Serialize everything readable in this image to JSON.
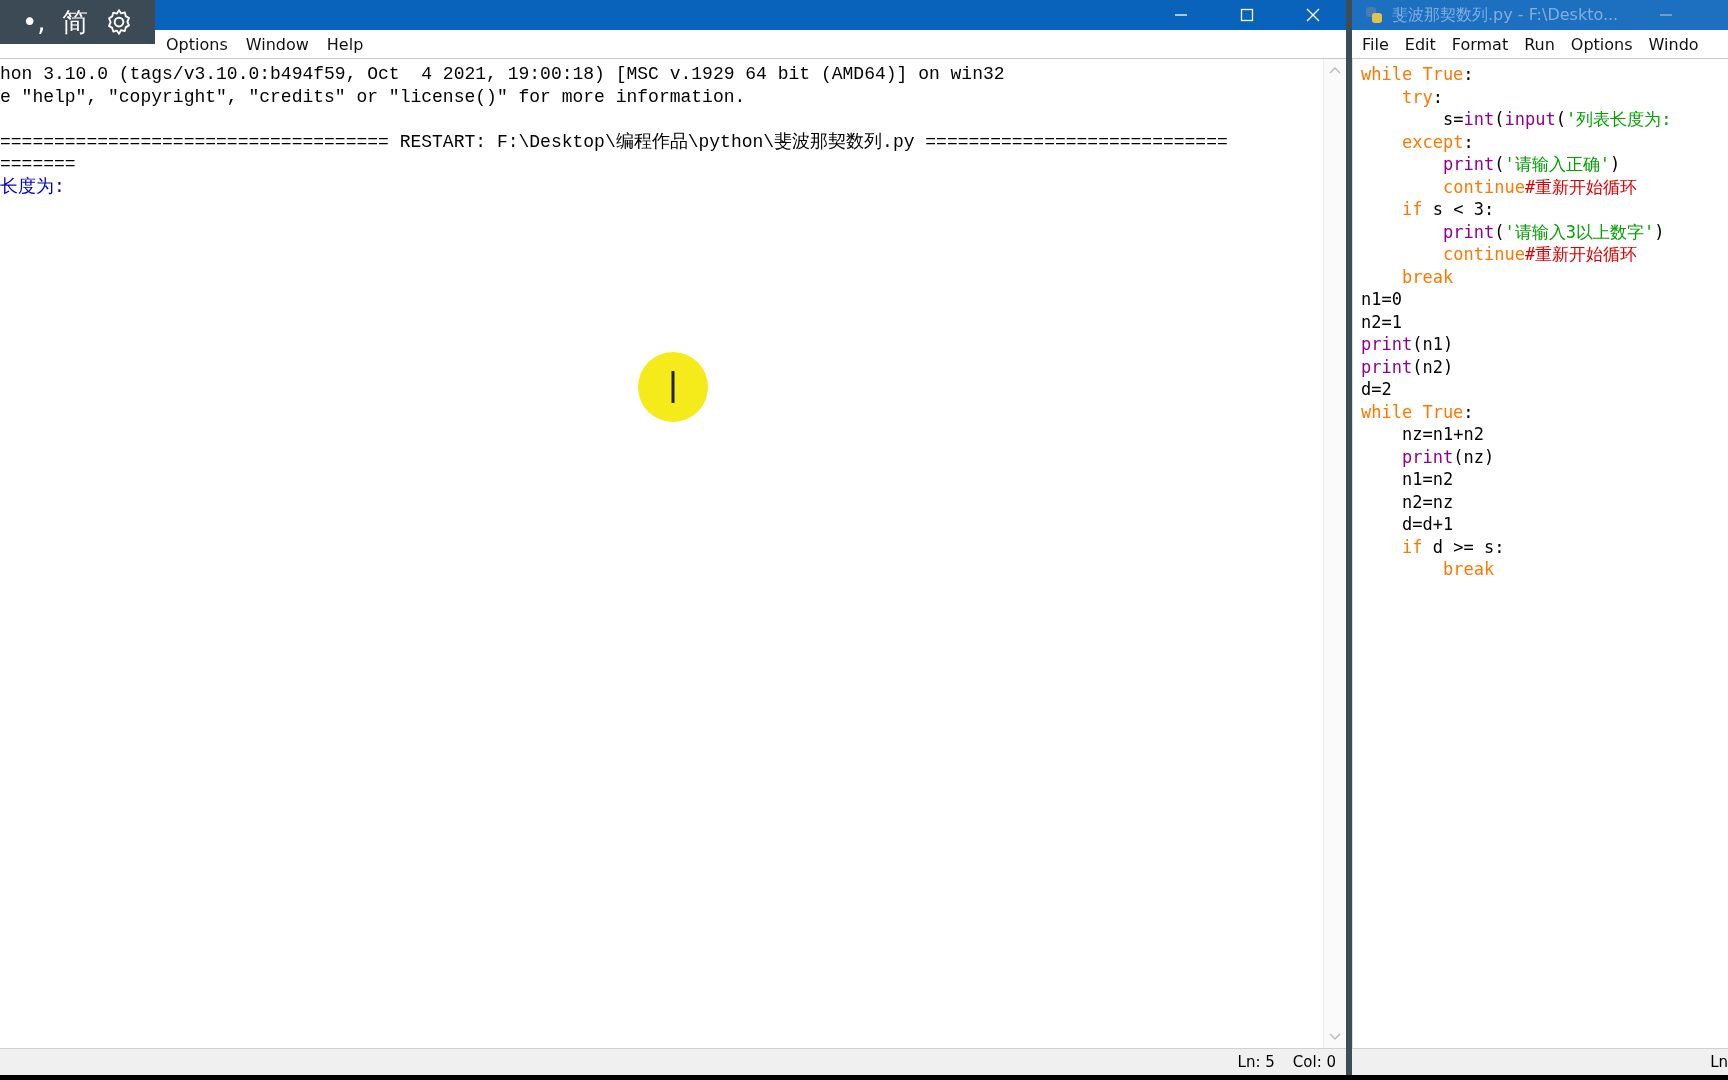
{
  "ime_toolbar": {
    "items": [
      {
        "kind": "text",
        "text": "•,"
      },
      {
        "kind": "text",
        "text": "简"
      },
      {
        "kind": "settings"
      }
    ]
  },
  "shell_window": {
    "menu": [
      "Options",
      "Window",
      "Help"
    ],
    "lines": [
      {
        "kind": "info",
        "text": "hon 3.10.0 (tags/v3.10.0:b494f59, Oct  4 2021, 19:00:18) [MSC v.1929 64 bit (AMD64)] on win32"
      },
      {
        "kind": "info",
        "text": "e \"help\", \"copyright\", \"credits\" or \"license()\" for more information."
      },
      {
        "kind": "blank"
      },
      {
        "kind": "info",
        "text": "==================================== RESTART: F:\\Desktop\\编程作品\\python\\斐波那契数列.py ============================"
      },
      {
        "kind": "info",
        "text": "======="
      },
      {
        "kind": "stdout",
        "text": "长度为:"
      }
    ],
    "status": [
      "Ln: 5",
      "Col: 0"
    ]
  },
  "editor_window": {
    "title": "斐波那契数列.py - F:\\Deskto...",
    "menu": [
      "File",
      "Edit",
      "Format",
      "Run",
      "Options",
      "Windo"
    ],
    "code": [
      {
        "tokens": [
          {
            "kind": "keyword",
            "text": "while True"
          },
          {
            "kind": "plain",
            "text": ":"
          }
        ],
        "children": [
          {
            "tokens": [
              {
                "kind": "keyword",
                "text": "try"
              },
              {
                "kind": "plain",
                "text": ":"
              }
            ],
            "children": [
              {
                "tokens": [
                  {
                    "kind": "plain",
                    "text": "s="
                  },
                  {
                    "kind": "builtin",
                    "text": "int"
                  },
                  {
                    "kind": "plain",
                    "text": "("
                  },
                  {
                    "kind": "builtin",
                    "text": "input"
                  },
                  {
                    "kind": "plain",
                    "text": "("
                  },
                  {
                    "kind": "string",
                    "text": "'列表长度为:"
                  }
                ]
              }
            ]
          },
          {
            "tokens": [
              {
                "kind": "keyword",
                "text": "except"
              },
              {
                "kind": "plain",
                "text": ":"
              }
            ],
            "children": [
              {
                "tokens": [
                  {
                    "kind": "builtin",
                    "text": "print"
                  },
                  {
                    "kind": "plain",
                    "text": "("
                  },
                  {
                    "kind": "string",
                    "text": "'请输入正确'"
                  },
                  {
                    "kind": "plain",
                    "text": ")"
                  }
                ]
              },
              {
                "tokens": [
                  {
                    "kind": "keyword",
                    "text": "continue"
                  },
                  {
                    "kind": "comment",
                    "text": "#重新开始循环"
                  }
                ]
              }
            ]
          },
          {
            "tokens": [
              {
                "kind": "keyword",
                "text": "if"
              },
              {
                "kind": "plain",
                "text": " s < 3:"
              }
            ],
            "children": [
              {
                "tokens": [
                  {
                    "kind": "builtin",
                    "text": "print"
                  },
                  {
                    "kind": "plain",
                    "text": "("
                  },
                  {
                    "kind": "string",
                    "text": "'请输入3以上数字'"
                  },
                  {
                    "kind": "plain",
                    "text": ")"
                  }
                ]
              },
              {
                "tokens": [
                  {
                    "kind": "keyword",
                    "text": "continue"
                  },
                  {
                    "kind": "comment",
                    "text": "#重新开始循环"
                  }
                ]
              }
            ]
          },
          {
            "tokens": [
              {
                "kind": "keyword",
                "text": "break"
              }
            ]
          }
        ]
      },
      {
        "tokens": [
          {
            "kind": "plain",
            "text": "n1=0"
          }
        ]
      },
      {
        "tokens": [
          {
            "kind": "plain",
            "text": "n2=1"
          }
        ]
      },
      {
        "tokens": [
          {
            "kind": "builtin",
            "text": "print"
          },
          {
            "kind": "plain",
            "text": "(n1)"
          }
        ]
      },
      {
        "tokens": [
          {
            "kind": "builtin",
            "text": "print"
          },
          {
            "kind": "plain",
            "text": "(n2)"
          }
        ]
      },
      {
        "tokens": [
          {
            "kind": "plain",
            "text": "d=2"
          }
        ]
      },
      {
        "tokens": [
          {
            "kind": "keyword",
            "text": "while True"
          },
          {
            "kind": "plain",
            "text": ":"
          }
        ],
        "children": [
          {
            "tokens": [
              {
                "kind": "plain",
                "text": "nz=n1+n2"
              }
            ]
          },
          {
            "tokens": [
              {
                "kind": "builtin",
                "text": "print"
              },
              {
                "kind": "plain",
                "text": "(nz)"
              }
            ]
          },
          {
            "tokens": [
              {
                "kind": "plain",
                "text": "n1=n2"
              }
            ]
          },
          {
            "tokens": [
              {
                "kind": "plain",
                "text": "n2=nz"
              }
            ]
          },
          {
            "tokens": [
              {
                "kind": "plain",
                "text": "d=d+1"
              }
            ]
          },
          {
            "tokens": [
              {
                "kind": "keyword",
                "text": "if"
              },
              {
                "kind": "plain",
                "text": " d >= s:"
              }
            ],
            "children": [
              {
                "tokens": [
                  {
                    "kind": "keyword",
                    "text": "break"
                  }
                ]
              }
            ]
          }
        ]
      }
    ],
    "status": [
      "Ln"
    ]
  }
}
